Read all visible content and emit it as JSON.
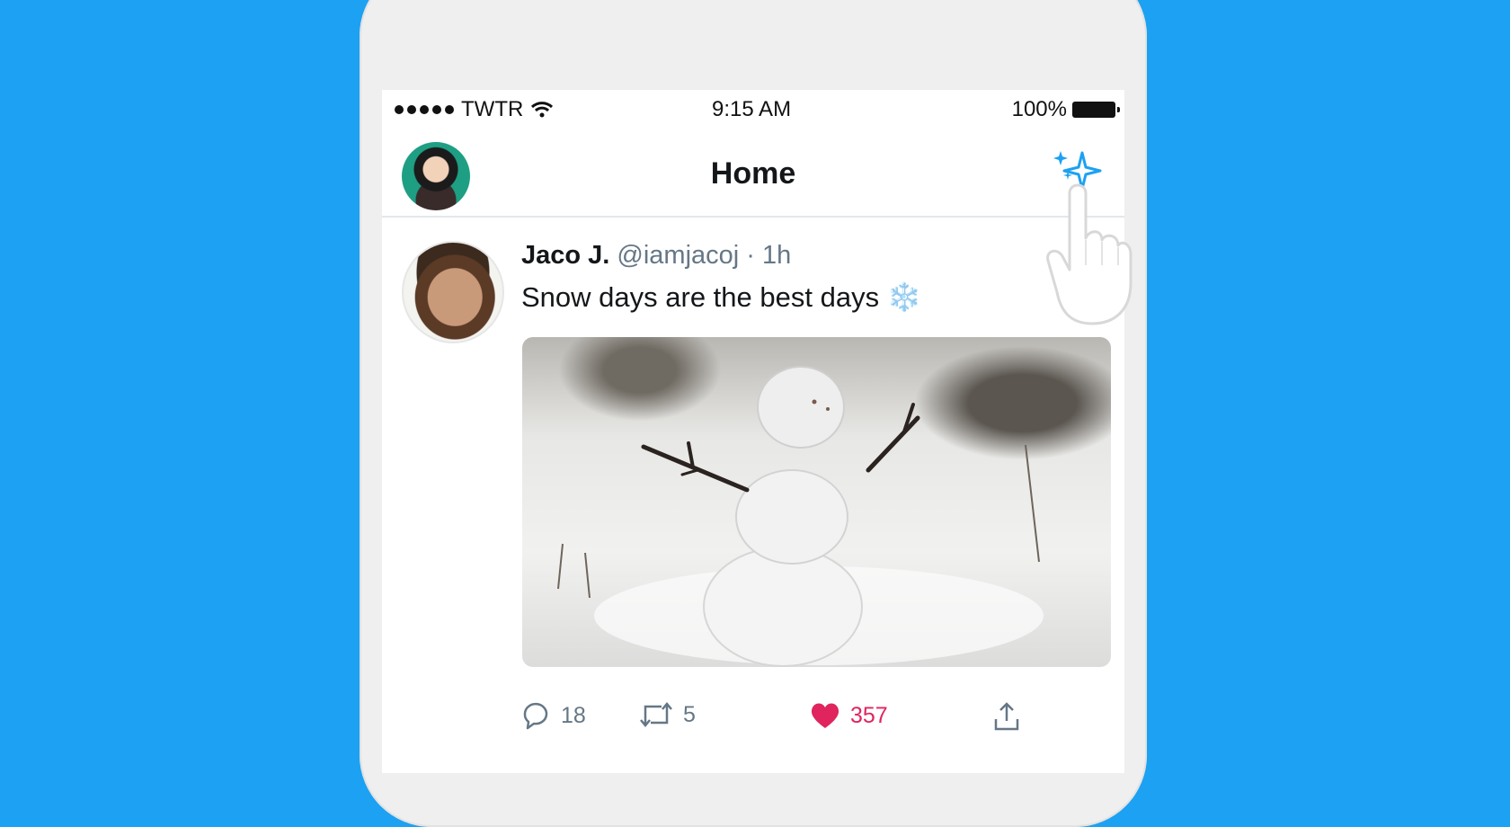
{
  "status_bar": {
    "carrier": "TWTR",
    "time": "9:15 AM",
    "battery": "100%"
  },
  "nav": {
    "title": "Home",
    "profile_icon": "user-avatar",
    "action_icon": "sparkle-icon"
  },
  "tweet": {
    "name": "Jaco J.",
    "handle": "@iamjacoj",
    "separator": "·",
    "time": "1h",
    "text": "Snow days are the best days",
    "emoji": "❄️",
    "actions": {
      "reply_count": "18",
      "retweet_count": "5",
      "like_count": "357"
    }
  },
  "colors": {
    "brand": "#1da1f2",
    "like": "#e0245e",
    "muted": "#657786"
  }
}
